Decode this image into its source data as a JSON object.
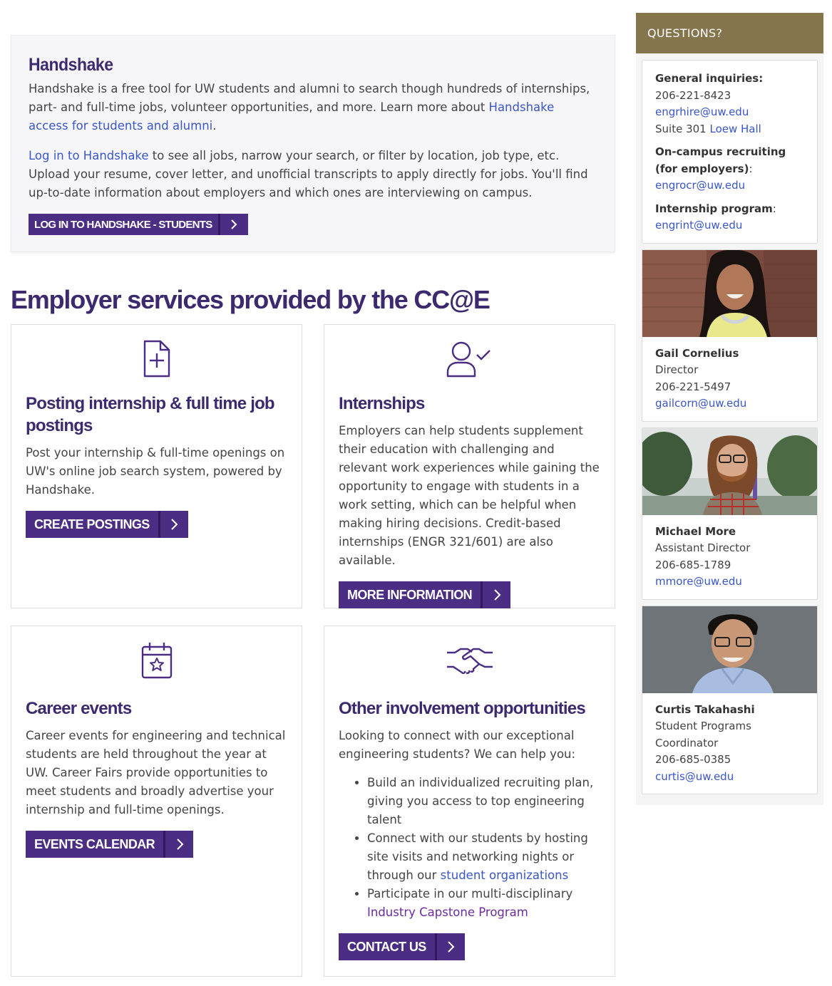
{
  "handshake": {
    "title": "Handshake",
    "p1_text": "Handshake is a free tool for UW students and alumni to search though hundreds of internships, part- and full-time jobs, volunteer opportunities, and more. Learn more about ",
    "p1_link": "Handshake access for students and alumni",
    "p1_end": ".",
    "p2_link": "Log in to Handshake",
    "p2_text": " to see all jobs, narrow your search, or filter by location, job type, etc. Upload your resume, cover letter, and unofficial transcripts to apply directly for jobs. You'll find up-to-date information about employers and which ones are interviewing on campus.",
    "button": "LOG IN TO HANDSHAKE - STUDENTS"
  },
  "section_title": "Employer services provided by the CC@E",
  "cards": {
    "posting": {
      "icon": "document-plus-icon",
      "title": "Posting internship & full time job postings",
      "text": "Post your internship & full-time openings on UW's online job search system, powered by Handshake.",
      "button": "CREATE POSTINGS"
    },
    "internships": {
      "icon": "user-check-icon",
      "title": "Internships",
      "text": "Employers can help students supplement their education with challenging and relevant work experiences while gaining the opportunity to engage with students in a work setting, which can be helpful when making hiring decisions. Credit-based internships (ENGR 321/601) are also available.",
      "button": "MORE INFORMATION"
    },
    "events": {
      "icon": "calendar-star-icon",
      "title": "Career events",
      "text": "Career events for engineering and technical students are held throughout the year at UW. Career Fairs provide opportunities to meet students and broadly advertise your internship and full-time openings.",
      "button": "EVENTS CALENDAR"
    },
    "other": {
      "icon": "handshake-icon",
      "title": "Other involvement opportunities",
      "text": "Looking to connect with our exceptional engineering students? We can help you:",
      "bullet1": "Build an individualized recruiting plan, giving you access to top engineering talent",
      "bullet2_text": "Connect with our students by hosting site visits and networking nights or through our ",
      "bullet2_link": "student organizations",
      "bullet3_text": "Participate in our multi-disciplinary ",
      "bullet3_link": "Industry Capstone Program",
      "button": "CONTACT US"
    }
  },
  "sidebar": {
    "header": "QUESTIONS?",
    "general_label": "General inquiries:",
    "general_phone": "206-221-8423",
    "general_email": "engrhire@uw.edu",
    "suite_text": "Suite 301 ",
    "suite_link": "Loew Hall",
    "oncampus_label": "On-campus recruiting (for employers)",
    "oncampus_colon": ":",
    "oncampus_email": "engrocr@uw.edu",
    "internship_label": "Internship program",
    "internship_colon": ":",
    "internship_email": "engrint@uw.edu",
    "people": [
      {
        "name": "Gail Cornelius",
        "title": "Director",
        "phone": "206-221-5497",
        "email": "gailcorn@uw.edu"
      },
      {
        "name": "Michael More",
        "title": "Assistant Director",
        "phone": "206-685-1789",
        "email": "mmore@uw.edu"
      },
      {
        "name": "Curtis Takahashi",
        "title": "Student Programs Coordinator",
        "phone": "206-685-0385",
        "email": "curtis@uw.edu"
      }
    ]
  },
  "colors": {
    "purple": "#4b2e83",
    "heading": "#3d2a6e",
    "gold": "#85754d",
    "link": "#3a56c8"
  }
}
